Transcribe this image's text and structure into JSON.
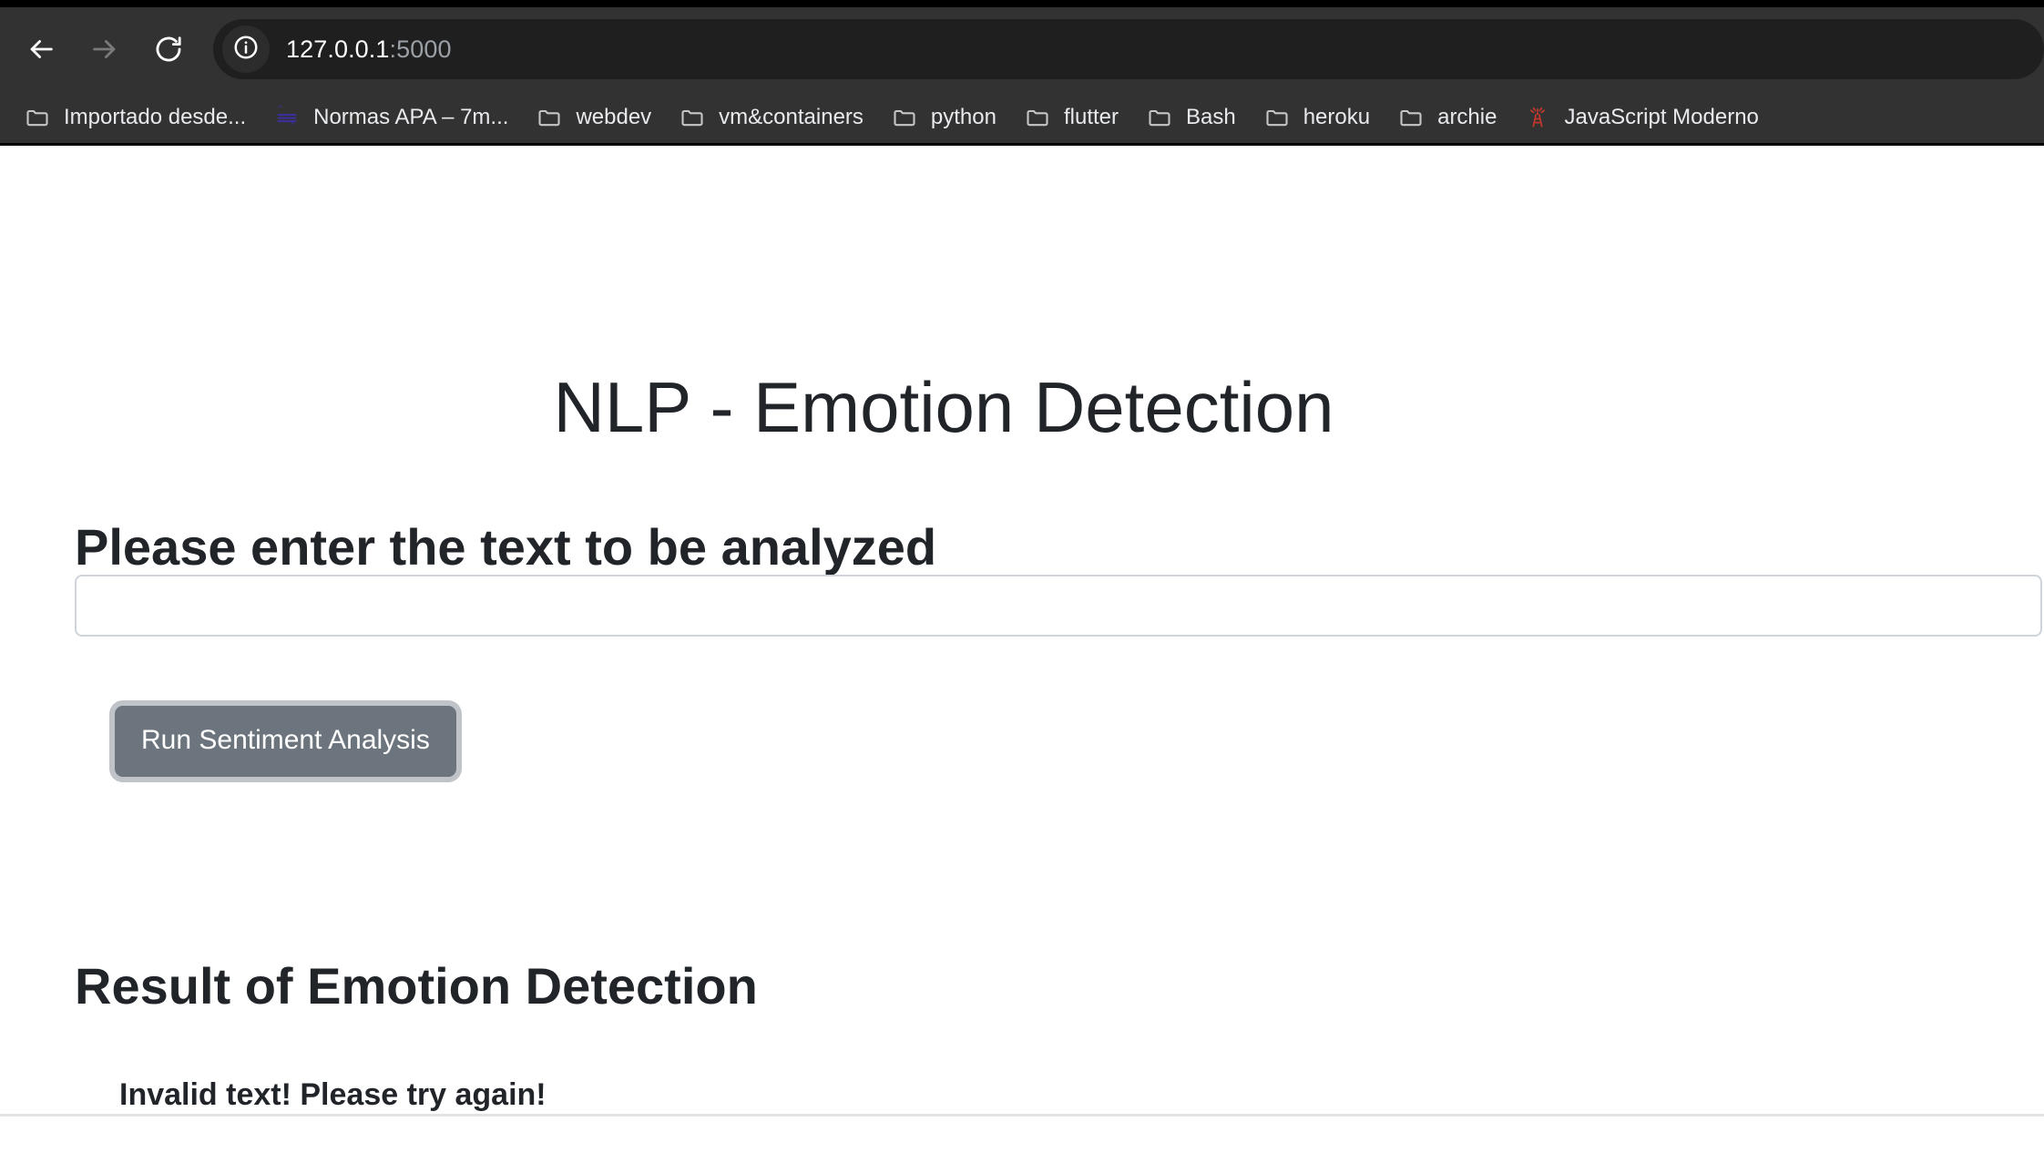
{
  "browser": {
    "nav": {
      "back_icon": "arrow-left-icon",
      "forward_icon": "arrow-right-icon",
      "reload_icon": "reload-icon"
    },
    "omnibox": {
      "site_info_icon": "info-circle-icon",
      "url_host": "127.0.0.1",
      "url_port": ":5000"
    },
    "bookmarks": [
      {
        "label": "Importado desde...",
        "icon": "folder-icon"
      },
      {
        "label": "Normas APA – 7m...",
        "icon": "quote-lines-favicon"
      },
      {
        "label": "webdev",
        "icon": "folder-icon"
      },
      {
        "label": "vm&containers",
        "icon": "folder-icon"
      },
      {
        "label": "python",
        "icon": "folder-icon"
      },
      {
        "label": "flutter",
        "icon": "folder-icon"
      },
      {
        "label": "Bash",
        "icon": "folder-icon"
      },
      {
        "label": "heroku",
        "icon": "folder-icon"
      },
      {
        "label": "archie",
        "icon": "folder-icon"
      },
      {
        "label": "JavaScript Moderno",
        "icon": "radio-tower-favicon"
      }
    ]
  },
  "page": {
    "title": "NLP - Emotion Detection",
    "prompt_heading": "Please enter the text to be analyzed",
    "input": {
      "value": "",
      "placeholder": ""
    },
    "run_button_label": "Run Sentiment Analysis",
    "result_heading": "Result of Emotion Detection",
    "result_message": "Invalid text! Please try again!"
  },
  "colors": {
    "chrome_bg": "#323232",
    "omnibox_bg": "#1f1f1f",
    "url_dim": "#9aa0a6",
    "button_bg": "#6c757d",
    "button_focus_ring": "rgba(130,138,145,.5)",
    "input_border": "#ced4da",
    "text": "#212529",
    "favicon_apa": "#3b2fa0",
    "favicon_js_moderno": "#c0392b",
    "divider": "#e3e3e3"
  }
}
